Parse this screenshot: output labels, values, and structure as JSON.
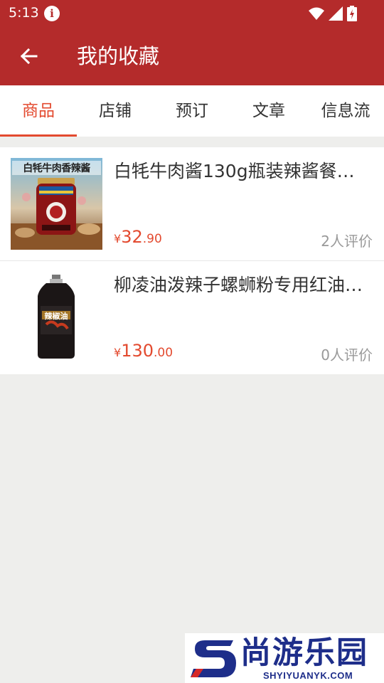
{
  "status_bar": {
    "time": "5:13",
    "info_glyph": "i"
  },
  "header": {
    "title": "我的收藏",
    "back_icon": "arrow-left-icon"
  },
  "tabs": [
    {
      "label": "商品",
      "active": true
    },
    {
      "label": "店铺",
      "active": false
    },
    {
      "label": "预订",
      "active": false
    },
    {
      "label": "文章",
      "active": false
    },
    {
      "label": "信息流",
      "active": false
    }
  ],
  "favorites": [
    {
      "title": "白牦牛肉酱130g瓶装辣酱餐…",
      "image_caption": "白牦牛肉香辣酱",
      "price_symbol": "¥",
      "price_int": "32",
      "price_dec": ".90",
      "reviews": "2人评价"
    },
    {
      "title": "柳凌油泼辣子螺蛳粉专用红油…",
      "image_caption": "辣椒油",
      "price_symbol": "¥",
      "price_int": "130",
      "price_dec": ".00",
      "reviews": "0人评价"
    }
  ],
  "watermark": {
    "brand": "尚游乐园",
    "url": "SHYIYUANYK.COM"
  },
  "colors": {
    "primary": "#b42b2b",
    "accent": "#e34a2f",
    "background": "#eeeeec"
  }
}
